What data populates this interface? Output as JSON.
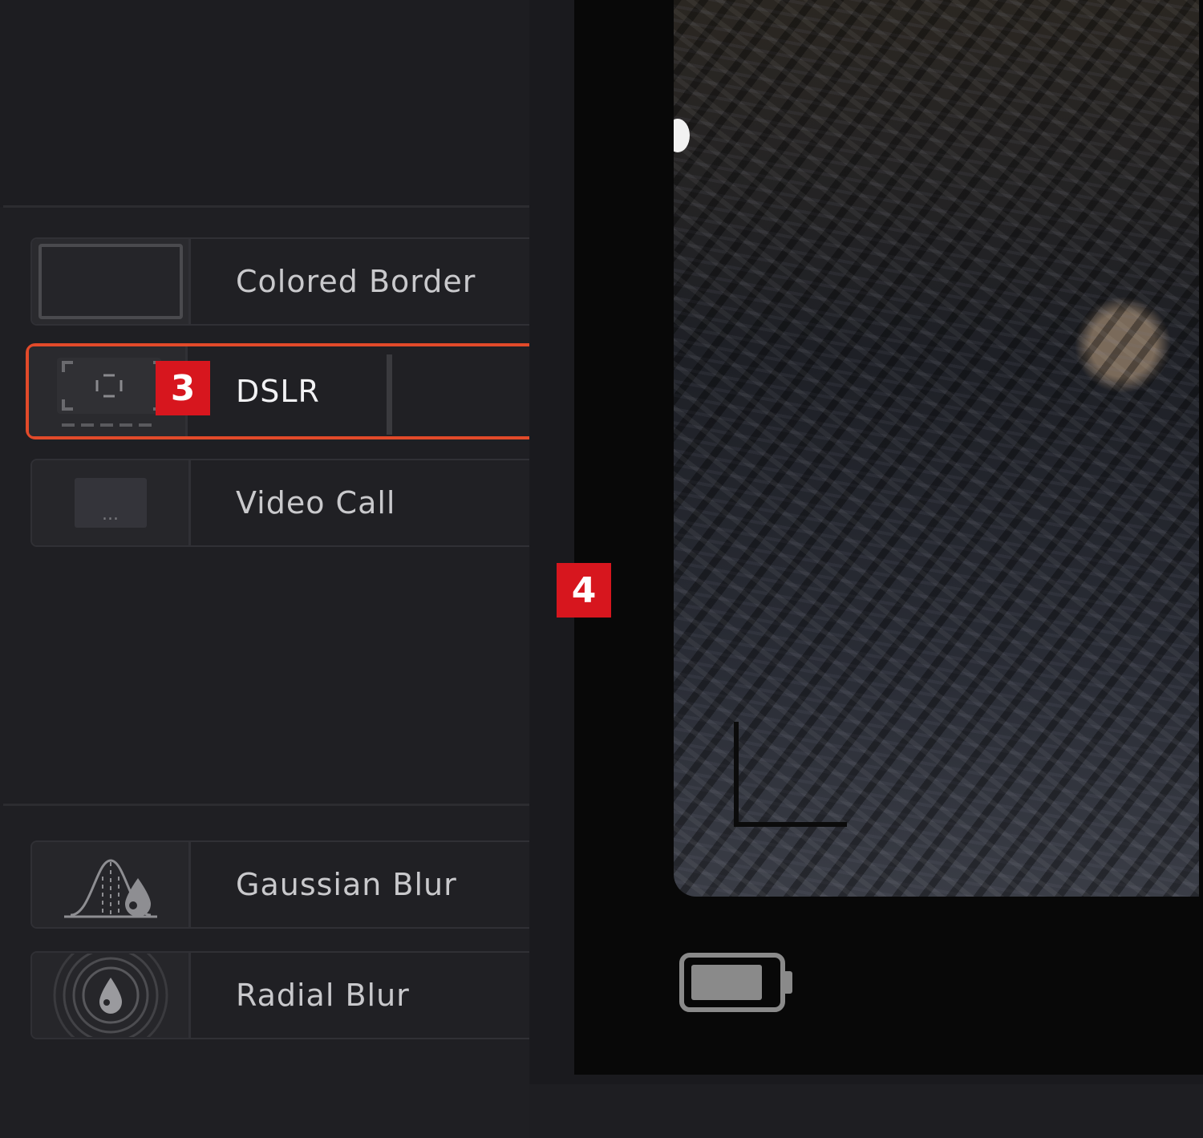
{
  "effects": {
    "colored_border": "Colored Border",
    "dslr": "DSLR",
    "video_call": "Video Call",
    "gaussian_blur": "Gaussian Blur",
    "radial_blur": "Radial Blur"
  },
  "video_call_thumb_text": "...",
  "badges": {
    "three": "3",
    "four": "4"
  },
  "colors": {
    "selection": "#e24a2a",
    "badge": "#d7161e"
  },
  "icons": {
    "dslr": "dslr-frame-icon",
    "gaussian": "gaussian-blur-icon",
    "radial": "radial-blur-icon",
    "battery": "battery-icon",
    "viewfinder": "viewfinder-corner-icon"
  }
}
